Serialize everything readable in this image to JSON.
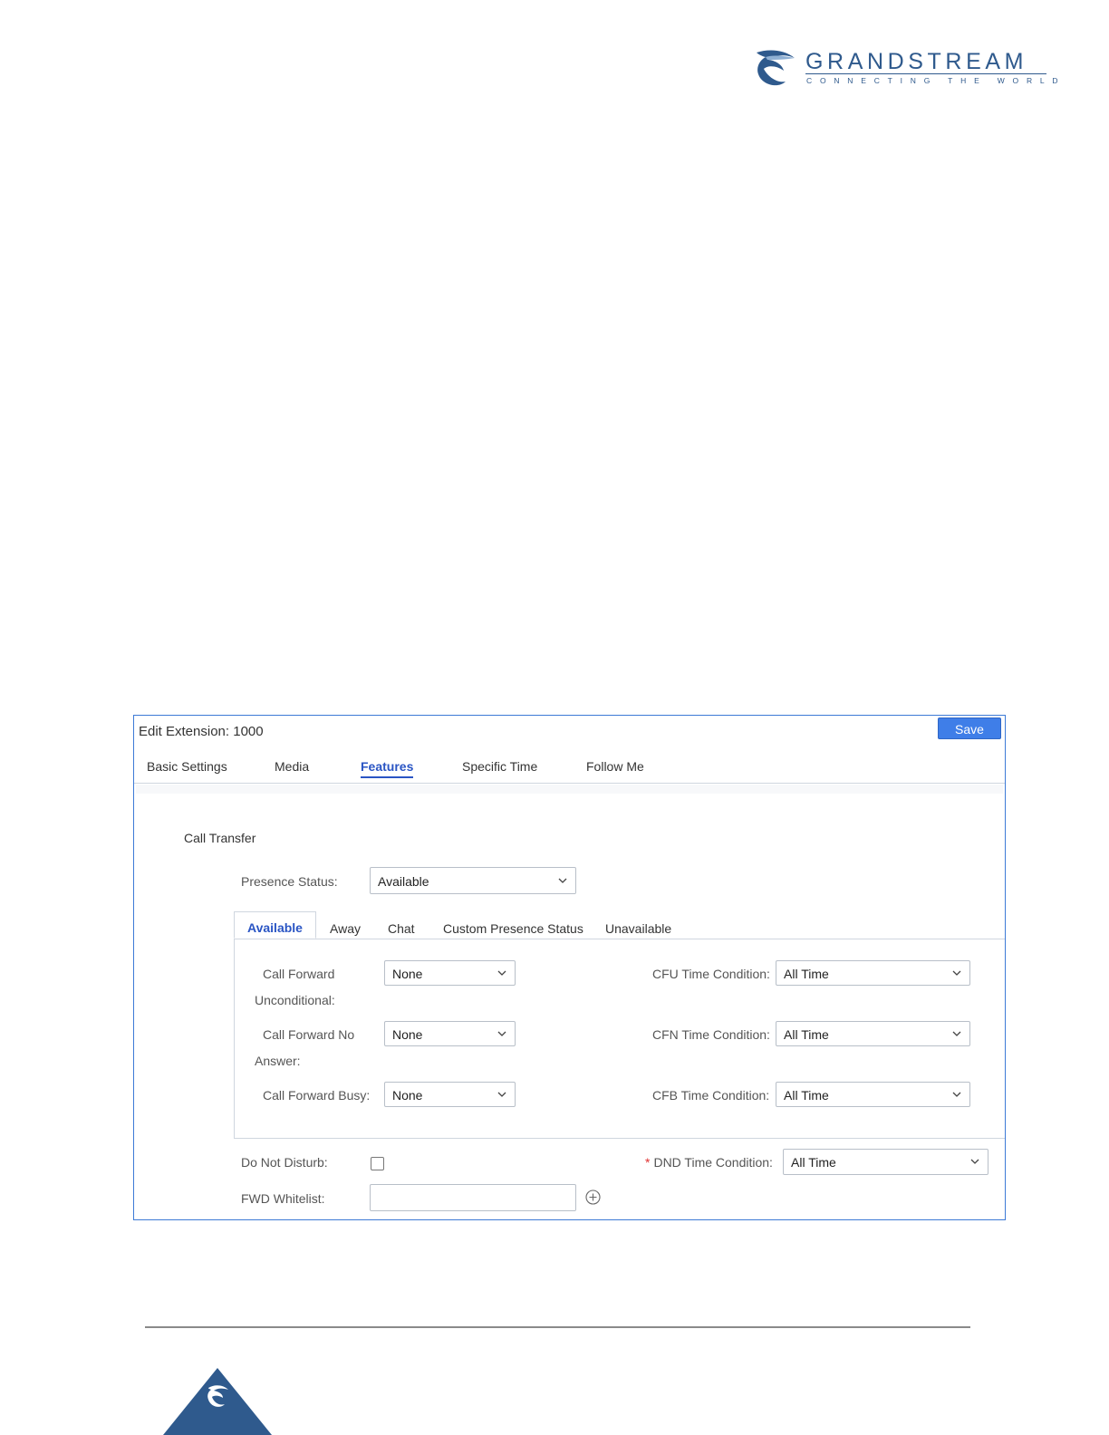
{
  "brand": {
    "name": "GRANDSTREAM",
    "tagline": "CONNECTING THE WORLD",
    "color": "#2f5a8d"
  },
  "panel": {
    "title": "Edit Extension: 1000",
    "save_label": "Save",
    "tabs": [
      "Basic Settings",
      "Media",
      "Features",
      "Specific Time",
      "Follow Me"
    ],
    "active_tab": "Features"
  },
  "features": {
    "section_title": "Call Transfer",
    "presence_status": {
      "label": "Presence Status:",
      "value": "Available"
    },
    "presence_tabs": [
      "Available",
      "Away",
      "Chat",
      "Custom Presence Status",
      "Unavailable"
    ],
    "active_presence_tab": "Available",
    "forwarding": {
      "cfu": {
        "label_line1": "Call Forward",
        "label_line2": "Unconditional:",
        "value": "None",
        "time_label": "CFU Time Condition:",
        "time_value": "All Time"
      },
      "cfn": {
        "label_line1": "Call Forward No",
        "label_line2": "Answer:",
        "value": "None",
        "time_label": "CFN Time Condition:",
        "time_value": "All Time"
      },
      "cfb": {
        "label": "Call Forward Busy:",
        "value": "None",
        "time_label": "CFB Time Condition:",
        "time_value": "All Time"
      }
    },
    "dnd": {
      "label": "Do Not Disturb:",
      "checked": false,
      "time_label": "DND Time Condition:",
      "time_value": "All Time",
      "required_mark": "*"
    },
    "fwd_whitelist": {
      "label": "FWD Whitelist:",
      "value": ""
    }
  },
  "colors": {
    "accent": "#2a55c4",
    "save_button": "#3f7ee8",
    "panel_border": "#3d7ad6"
  }
}
